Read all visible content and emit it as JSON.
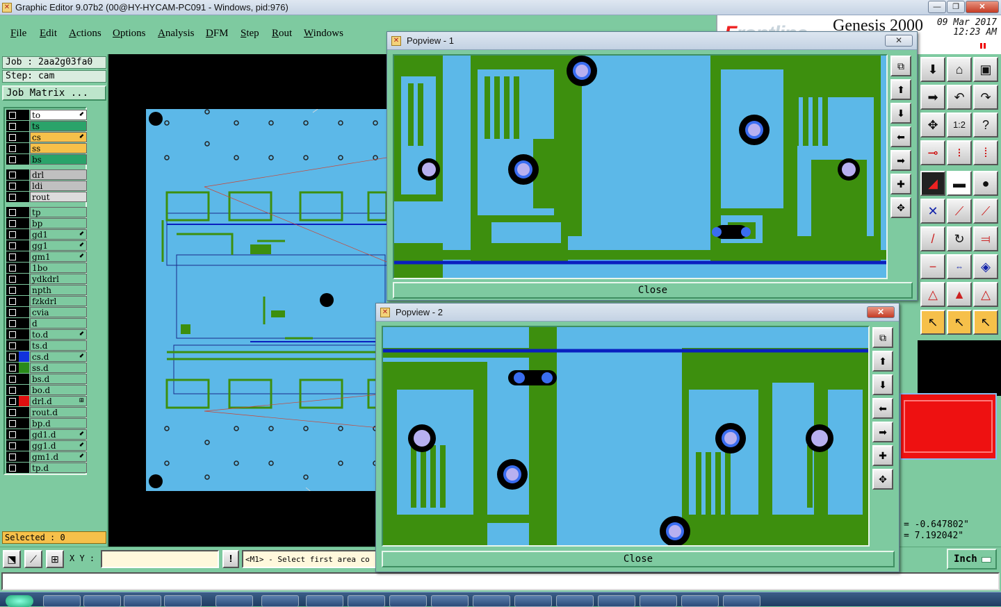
{
  "window": {
    "title": "Graphic Editor 9.07b2 (00@HY-HYCAM-PC091 - Windows, pid:976)",
    "minimize": "—",
    "maximize": "❐",
    "close": "✕"
  },
  "menu": [
    "File",
    "Edit",
    "Actions",
    "Options",
    "Analysis",
    "DFM",
    "Step",
    "Rout",
    "Windows"
  ],
  "brand": {
    "logo_prefix": "F",
    "logo_rest": "rontline",
    "product": "Genesis 2000",
    "date": "09 Mar 2017",
    "time": "12:23 AM"
  },
  "job": {
    "job_line": "Job : 2aa2g03fa0",
    "step_line": "Step: cam",
    "matrix_button": "Job Matrix ..."
  },
  "layers": [
    {
      "name": "to",
      "color": "#ffffff",
      "mark": "⬋"
    },
    {
      "name": "ts",
      "color": "#2aa36a",
      "mark": ""
    },
    {
      "name": "cs",
      "color": "#f6c04a",
      "mark": "⬋"
    },
    {
      "name": "ss",
      "color": "#f6c04a",
      "mark": ""
    },
    {
      "name": "bs",
      "color": "#2aa36a",
      "mark": ""
    },
    {
      "name": "drl",
      "color": "#c0c0c0",
      "mark": ""
    },
    {
      "name": "ldi",
      "color": "#c0c0c0",
      "mark": ""
    },
    {
      "name": "rout",
      "color": "#dcdcdc",
      "mark": ""
    },
    {
      "name": "tp",
      "color": "#7ecaa0",
      "mark": ""
    },
    {
      "name": "bp",
      "color": "#7ecaa0",
      "mark": ""
    },
    {
      "name": "gd1",
      "color": "#7ecaa0",
      "mark": "⬋"
    },
    {
      "name": "gg1",
      "color": "#7ecaa0",
      "mark": "⬋"
    },
    {
      "name": "gm1",
      "color": "#7ecaa0",
      "mark": "⬋"
    },
    {
      "name": "1bo",
      "color": "#7ecaa0",
      "mark": ""
    },
    {
      "name": "ydkdrl",
      "color": "#7ecaa0",
      "mark": ""
    },
    {
      "name": "npth",
      "color": "#7ecaa0",
      "mark": ""
    },
    {
      "name": "fzkdrl",
      "color": "#7ecaa0",
      "mark": ""
    },
    {
      "name": "cvia",
      "color": "#7ecaa0",
      "mark": ""
    },
    {
      "name": "d",
      "color": "#7ecaa0",
      "mark": ""
    },
    {
      "name": "to.d",
      "color": "#7ecaa0",
      "mark": "⬋"
    },
    {
      "name": "ts.d",
      "color": "#7ecaa0",
      "mark": ""
    },
    {
      "name": "cs.d",
      "color": "#7ecaa0",
      "mark": "⬋"
    },
    {
      "name": "ss.d",
      "color": "#7ecaa0",
      "mark": ""
    },
    {
      "name": "bs.d",
      "color": "#7ecaa0",
      "mark": ""
    },
    {
      "name": "bo.d",
      "color": "#7ecaa0",
      "mark": ""
    },
    {
      "name": "drl.d",
      "color": "#7ecaa0",
      "mark": "⊞"
    },
    {
      "name": "rout.d",
      "color": "#7ecaa0",
      "mark": ""
    },
    {
      "name": "bp.d",
      "color": "#7ecaa0",
      "mark": ""
    },
    {
      "name": "gd1.d",
      "color": "#7ecaa0",
      "mark": "⬋"
    },
    {
      "name": "gg1.d",
      "color": "#7ecaa0",
      "mark": "⬋"
    },
    {
      "name": "gm1.d",
      "color": "#7ecaa0",
      "mark": "⬋"
    },
    {
      "name": "tp.d",
      "color": "#7ecaa0",
      "mark": ""
    }
  ],
  "selected": "Selected : 0",
  "bottom": {
    "xy_label": "X Y :",
    "xy_value": "",
    "warn": "!",
    "prompt": "<M1> - Select first area co",
    "unit": "Inch"
  },
  "coords": {
    "x": "= -0.647802\"",
    "y": "= 7.192042\""
  },
  "popview1": {
    "title": "Popview - 1",
    "close": "Close"
  },
  "popview2": {
    "title": "Popview - 2",
    "close": "Close"
  },
  "colors": {
    "board": "#5cb8e8",
    "copper": "#3d8f0e",
    "mask": "#1e2cd0",
    "pad": "#b8b0f0"
  }
}
